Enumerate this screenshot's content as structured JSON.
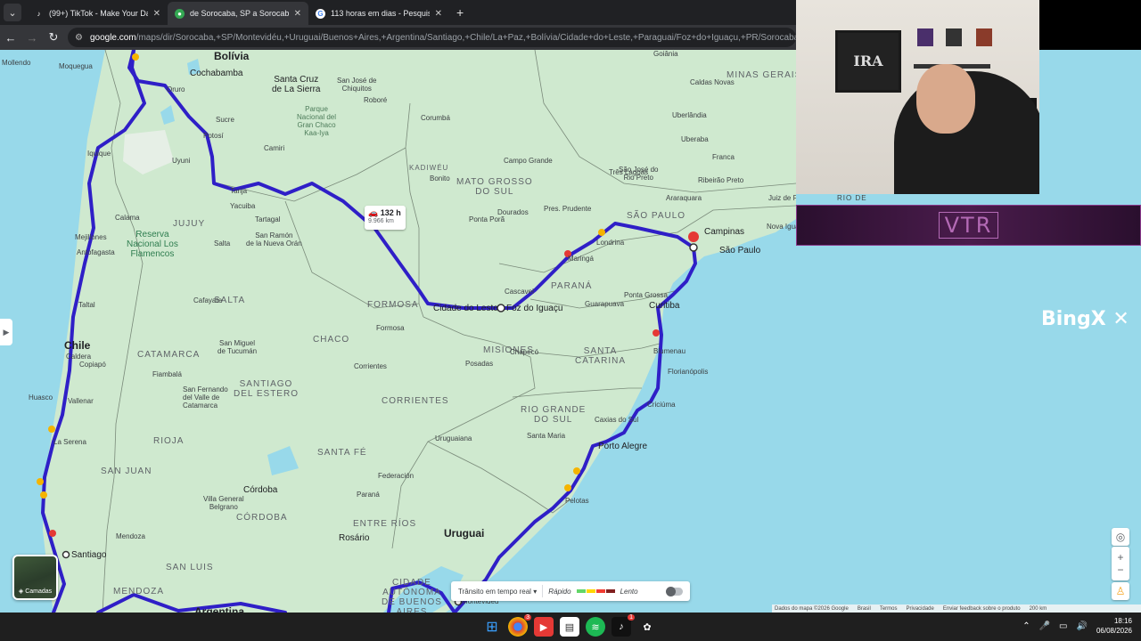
{
  "browser": {
    "tabs": [
      {
        "title": "(99+) TikTok - Make Your Day",
        "icon": "tiktok-icon",
        "active": false
      },
      {
        "title": "de Sorocaba, SP a Sorocaba, SP",
        "icon": "maps-pin-icon",
        "active": true
      },
      {
        "title": "113 horas em dias - Pesquisa G",
        "icon": "google-icon",
        "active": false
      }
    ],
    "url_host": "google.com",
    "url_path": "/maps/dir/Sorocaba,+SP/Montevidéu,+Uruguai/Buenos+Aires,+Argentina/Santiago,+Chile/La+Paz,+Bolívia/Cidade+do+Leste,+Paraguai/Foz+do+Iguaçu,+PR/Sorocaba,+SP/@-26"
  },
  "map": {
    "route_time": "132 h",
    "route_distance": "9.966 km",
    "labels": {
      "bolivia": "Bolívia",
      "chile": "Chile",
      "uruguai": "Uruguai",
      "argentina": "Argentina",
      "santa_cruz": "Santa Cruz\nde La Sierra",
      "cochabamba": "Cochabamba",
      "mollendo": "Mollendo",
      "moquegua": "Moquegua",
      "oruro": "Oruro",
      "sucre": "Sucre",
      "potosi": "Potosí",
      "uyuni": "Uyuni",
      "camiri": "Camiri",
      "tarija": "Tarija",
      "yacuiba": "Yacuiba",
      "tartagal": "Tartagal",
      "san_jose": "San José de\nChiquitos",
      "robore": "Roboré",
      "corumba": "Corumbá",
      "kaa_iya": "Parque\nNacional del\nGran Chaco\nKaa-Iya",
      "calama": "Calama",
      "iquique": "Iquique",
      "arica": "Arica",
      "jujuy": "JUJUY",
      "salta_state": "SALTA",
      "salta": "Salta",
      "san_ramon": "San Ramón\nde la Nueva Orán",
      "reserva": "Reserva\nNacional Los\nFlamencos",
      "mejillones": "Mejillones",
      "antofagasta": "Antofagasta",
      "taltal": "Taltal",
      "caldera": "Caldera",
      "copiapo": "Copiapó",
      "vallenar": "Vallenar",
      "huasco": "Huasco",
      "la_serena": "La Serena",
      "cafayate": "Cafayate",
      "catamarca": "CATAMARCA",
      "san_miguel": "San Miguel\nde Tucumán",
      "fiambala": "Fiambalá",
      "santiago_estero": "SANTIAGO\nDEL ESTERO",
      "san_fernando": "San Fernando\ndel Valle de\nCatamarca",
      "la_rioja": "RIOJA",
      "san_juan": "SAN JUAN",
      "cordoba": "Córdoba",
      "cordoba_state": "CÓRDOBA",
      "villa_general": "Villa General\nBelgrano",
      "san_luis": "SAN LUIS",
      "mendoza": "MENDOZA",
      "mendoza_city": "Mendoza",
      "santiago": "Santiago",
      "chaco": "CHACO",
      "formosa": "FORMOSA",
      "formosa_city": "Formosa",
      "corrientes": "CORRIENTES",
      "corrientes_city": "Corrientes",
      "misiones": "MISIONES",
      "posadas": "Posadas",
      "santa_fe": "SANTA FÉ",
      "entre_rios": "ENTRE RÍOS",
      "rosario": "Rosário",
      "parana_city": "Paraná",
      "cidade_autonoma": "CIDADE\nAUTÔNOMA\nDE BUENOS\nAIRES",
      "montevideu": "Montevidéu",
      "cidade_do_leste": "Cidade do Leste",
      "foz": "Foz do Iguaçu",
      "ponta_pora": "Ponta Porã",
      "dourados": "Dourados",
      "mato_grosso": "MATO GROSSO\nDO SUL",
      "campo_grande": "Campo Grande",
      "bonito": "Bonito",
      "kadiweu": "KADIWÉU",
      "tres_lagoas": "Três Lagoas",
      "presidente_prudente": "Pres. Prudente",
      "sao_paulo_state": "SÃO PAULO",
      "sao_paulo": "São Paulo",
      "campinas": "Campinas",
      "londrina": "Londrina",
      "maringa": "Maringá",
      "cascavel": "Cascavel",
      "guarapuava": "Guarapuava",
      "ponta_grossa": "Ponta Grossa",
      "curitiba": "Curitiba",
      "parana_state": "PARANÁ",
      "santa_catarina": "SANTA\nCATARINA",
      "blumenau": "Blumenau",
      "florianopolis": "Florianópolis",
      "criciuma": "Criciúma",
      "chapeco": "Chapecó",
      "rio_grande_do_sul": "RIO GRANDE\nDO SUL",
      "caxias": "Caxias do Sul",
      "porto_alegre": "Porto Alegre",
      "santa_maria": "Santa Maria",
      "uruguaiana": "Uruguaiana",
      "pelotas": "Pelotas",
      "federacion": "Federación",
      "minas_gerais": "MINAS GERAIS",
      "goiania": "Goiânia",
      "uberlandia": "Uberlândia",
      "uberaba": "Uberaba",
      "franca": "Franca",
      "ribeirao": "Ribeirão Preto",
      "araraquara": "Araraquara",
      "sao_jose_rio_preto": "São José do\nRio Preto",
      "juiz_de_fora": "Juiz de Fora",
      "nova_iguacu": "Nova Iguaçu",
      "caldas_novas": "Caldas Novas",
      "mendoza_dept": "Mendoza",
      "rio_de": "RIO DE"
    },
    "traffic_label": "Trânsito em tempo real",
    "traffic_fast": "Rápido",
    "traffic_slow": "Lento",
    "layers_label": "Camadas",
    "footer": [
      "Dados do mapa ©2026 Google",
      "Brasil",
      "Termos",
      "Privacidade",
      "Enviar feedback sobre o produto",
      "200 km"
    ]
  },
  "overlay": {
    "frame_text": "IRA",
    "banner_text": "VTR",
    "bingx_text": "BingX"
  },
  "taskbar": {
    "time": "18:16",
    "date": "06/08/2026",
    "badge_chrome": "3",
    "badge_app": "1"
  },
  "colors": {
    "route": "#2f1fc7",
    "water": "#98d9ea",
    "land": "#cfe9cf"
  }
}
